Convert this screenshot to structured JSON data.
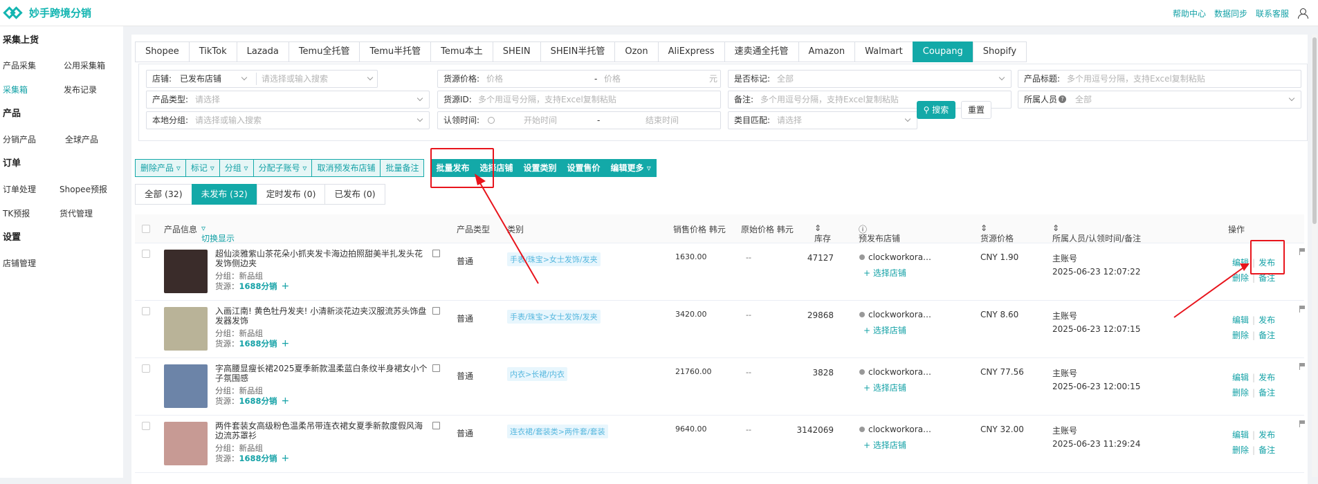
{
  "app": {
    "title": "妙手跨境分销",
    "links": [
      "帮助中心",
      "数据同步",
      "联系客服"
    ]
  },
  "sidebar": {
    "groups": [
      {
        "title": "采集上货",
        "items": [
          "产品采集",
          "公用采集箱",
          "采集箱",
          "发布记录"
        ]
      },
      {
        "title": "产品",
        "items": [
          "分销产品",
          "全球产品"
        ]
      },
      {
        "title": "订单",
        "items": [
          "订单处理",
          "Shopee预报",
          "TK预报",
          "货代管理"
        ]
      },
      {
        "title": "设置",
        "items": [
          "店铺管理"
        ]
      }
    ]
  },
  "platform_tabs": [
    "Shopee",
    "TikTok",
    "Lazada",
    "Temu全托管",
    "Temu半托管",
    "Temu本土",
    "SHEIN",
    "SHEIN半托管",
    "Ozon",
    "AliExpress",
    "速卖通全托管",
    "Amazon",
    "Walmart",
    "Coupang",
    "Shopify"
  ],
  "filters": {
    "shop_label": "店铺:",
    "shop_value": "已发布店铺",
    "shop_search_ph": "请选择或输入搜索",
    "cost_label": "货源价格:",
    "price_min_ph": "价格",
    "dash": "-",
    "price_max_ph": "价格",
    "currency": "元",
    "mark_label": "是否标记:",
    "mark_value": "全部",
    "ptitle_label": "产品标题:",
    "ptitle_ph": "多个用逗号分隔，支持Excel复制粘贴",
    "ptype_label": "产品类型:",
    "ptype_ph": "请选择",
    "srcid_label": "货源ID:",
    "srcid_ph": "多个用逗号分隔，支持Excel复制粘贴",
    "remark_label": "备注:",
    "remark_ph": "多个用逗号分隔，支持Excel复制粘贴",
    "owner_label": "所属人员",
    "owner_value": "全部",
    "group_label": "本地分组:",
    "group_ph": "请选择或输入搜索",
    "claim_label": "认领时间:",
    "start_ph": "开始时间",
    "end_ph": "结束时间",
    "catmatch_label": "类目匹配:",
    "catmatch_ph": "请选择",
    "search_btn": "搜索",
    "reset_btn": "重置"
  },
  "action_buttons": [
    {
      "label": "删除产品",
      "solid": false,
      "dd": true
    },
    {
      "label": "标记",
      "solid": false,
      "dd": true
    },
    {
      "label": "分组",
      "solid": false,
      "dd": true
    },
    {
      "label": "分配子账号",
      "solid": false,
      "dd": true
    },
    {
      "label": "取消预发布店铺",
      "solid": false,
      "dd": false
    },
    {
      "label": "批量备注",
      "solid": false,
      "dd": false
    },
    {
      "label": "批量发布",
      "solid": true,
      "dd": false
    },
    {
      "label": "选择店铺",
      "solid": true,
      "dd": false
    },
    {
      "label": "设置类别",
      "solid": true,
      "dd": false
    },
    {
      "label": "设置售价",
      "solid": true,
      "dd": false
    },
    {
      "label": "编辑更多",
      "solid": true,
      "dd": true
    }
  ],
  "status_tabs": [
    {
      "label": "全部 (32)",
      "active": false
    },
    {
      "label": "未发布 (32)",
      "active": true
    },
    {
      "label": "定时发布 (0)",
      "active": false
    },
    {
      "label": "已发布 (0)",
      "active": false
    }
  ],
  "table": {
    "headers": {
      "info": "产品信息",
      "toggle": "切换显示",
      "ptype": "产品类型",
      "cat": "类别",
      "price": "销售价格 韩元",
      "orig": "原始价格 韩元",
      "stock": "库存",
      "shop": "预发布店铺",
      "cost": "货源价格",
      "owner": "所属人员/认领时间/备注",
      "op": "操作"
    },
    "group_prefix": "分组：",
    "source_prefix": "货源：",
    "rows": [
      {
        "title": "超仙淡雅紫山茶花朵小抓夹发卡海边拍照甜美半扎发头花发饰侧边夹",
        "group": "新品组",
        "source": "1688分销",
        "ptype": "普通",
        "category": "手表/珠宝>女士发饰/发夹",
        "price": "1630.00",
        "orig": "--",
        "stock": "47127",
        "shop": "clockworkora…",
        "pick": "+ 选择店铺",
        "cost": "CNY 1.90",
        "owner": "主账号",
        "time": "2025-06-23 12:07:22",
        "ops": [
          "编辑",
          "发布",
          "删除",
          "备注"
        ],
        "img": "#3a2c2a"
      },
      {
        "title": "入画江南! 黄色牡丹发夹! 小清新淡花边夹汉服流苏头饰盘发器发饰",
        "group": "新品组",
        "source": "1688分销",
        "ptype": "普通",
        "category": "手表/珠宝>女士发饰/发夹",
        "price": "3420.00",
        "orig": "--",
        "stock": "29868",
        "shop": "clockworkora…",
        "pick": "+ 选择店铺",
        "cost": "CNY 8.60",
        "owner": "主账号",
        "time": "2025-06-23 12:07:15",
        "ops": [
          "编辑",
          "发布",
          "删除",
          "备注"
        ],
        "img": "#b9b398"
      },
      {
        "title": "字高腰显瘦长裙2025夏季新款温柔蓝白条纹半身裙女小个子氛围感",
        "group": "新品组",
        "source": "1688分销",
        "ptype": "普通",
        "category": "内衣>长裙/内衣",
        "price": "21760.00",
        "orig": "--",
        "stock": "3828",
        "shop": "clockworkora…",
        "pick": "+ 选择店铺",
        "cost": "CNY 77.56",
        "owner": "主账号",
        "time": "2025-06-23 12:00:15",
        "ops": [
          "编辑",
          "发布",
          "删除",
          "备注"
        ],
        "img": "#6c84a8"
      },
      {
        "title": "两件套装女高级粉色温柔吊带连衣裙女夏季新款度假风海边流苏罩衫",
        "group": "新品组",
        "source": "1688分销",
        "ptype": "普通",
        "category": "连衣裙/套装类>两件套/套装",
        "price": "9640.00",
        "orig": "--",
        "stock": "3142069",
        "shop": "clockworkora…",
        "pick": "+ 选择店铺",
        "cost": "CNY 32.00",
        "owner": "主账号",
        "time": "2025-06-23 11:29:24",
        "ops": [
          "编辑",
          "发布",
          "删除",
          "备注"
        ],
        "img": "#c79a94"
      }
    ]
  },
  "colors": {
    "accent": "#13a9a8",
    "highlight": "#e8141c"
  }
}
